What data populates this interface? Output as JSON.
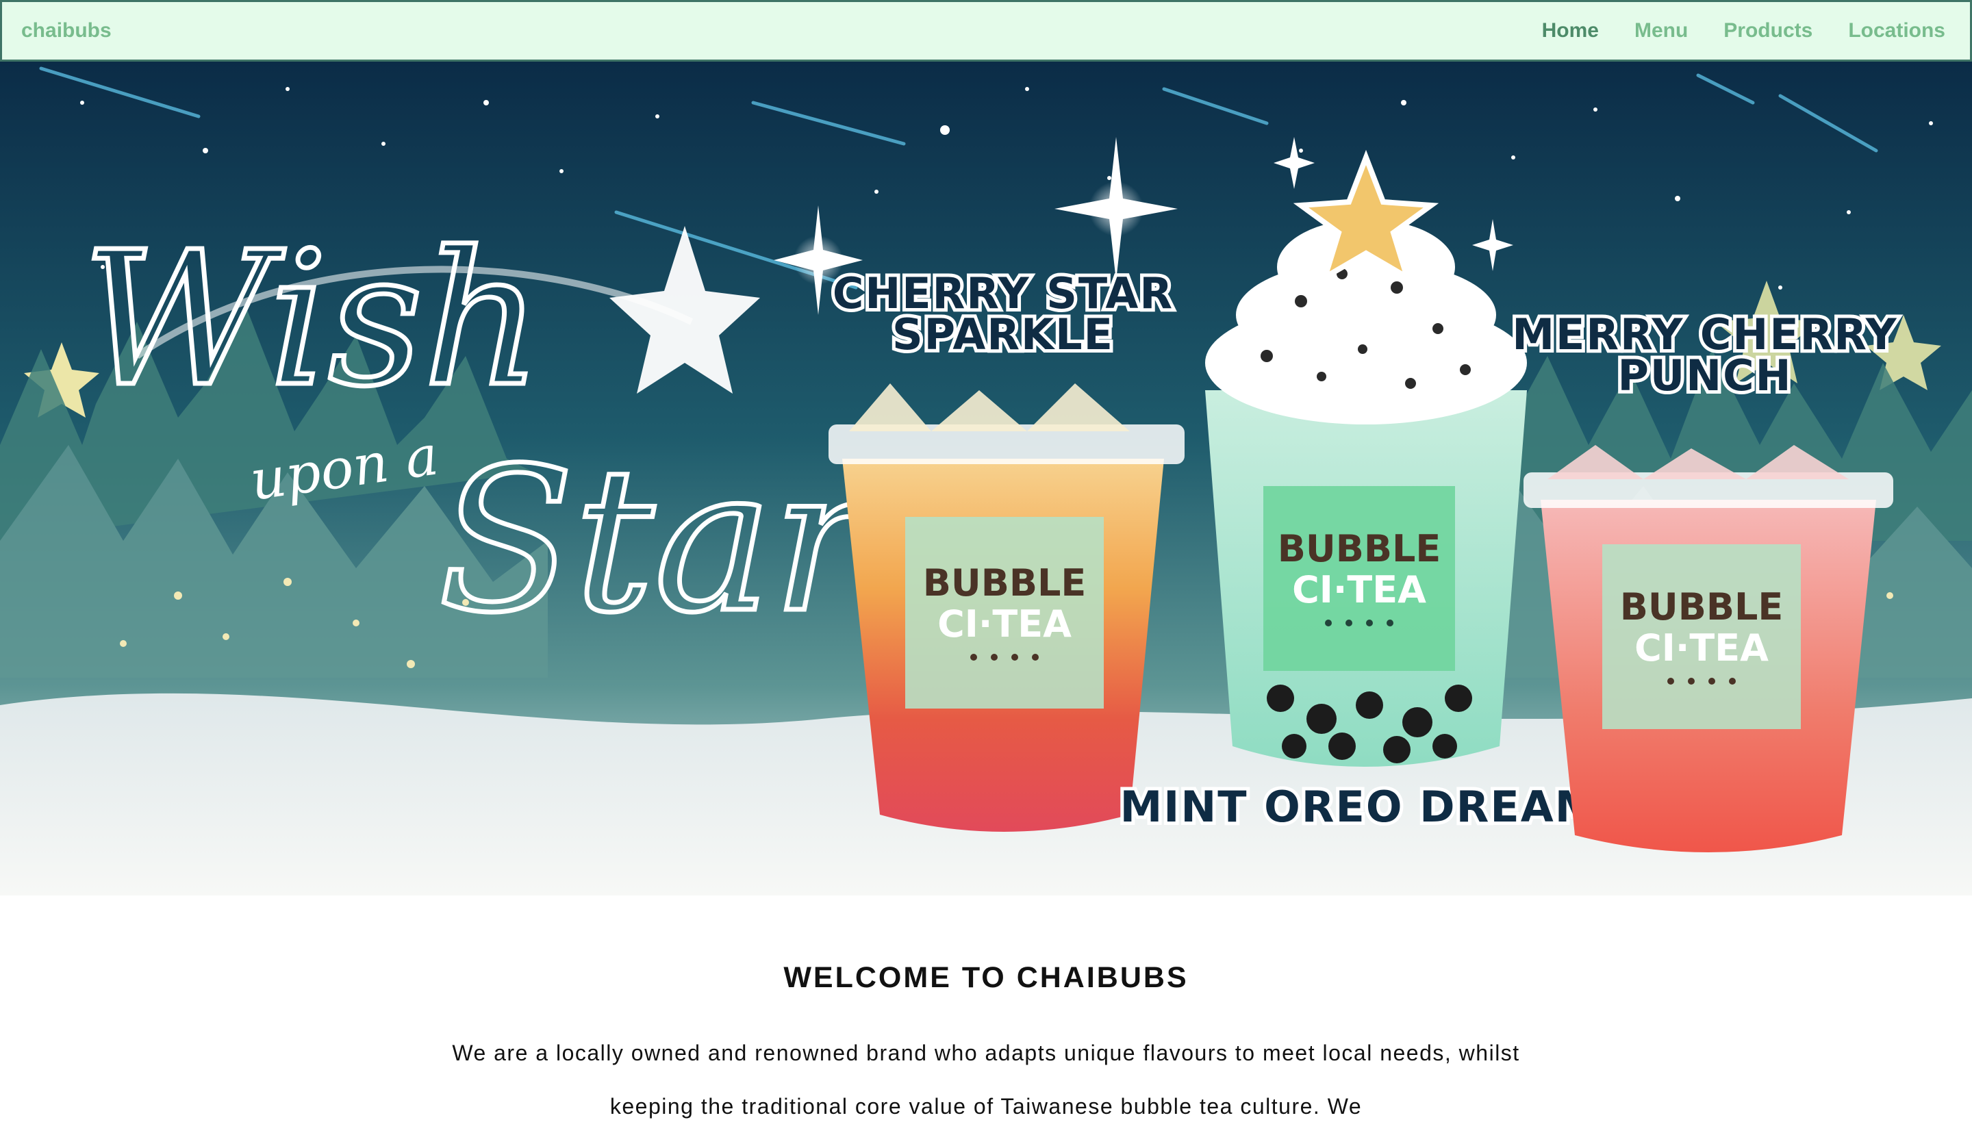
{
  "navbar": {
    "brand": "chaibubs",
    "links": [
      {
        "label": "Home",
        "active": true
      },
      {
        "label": "Menu",
        "active": false
      },
      {
        "label": "Products",
        "active": false
      },
      {
        "label": "Locations",
        "active": false
      }
    ]
  },
  "hero": {
    "script_wish": "Wish",
    "script_upon": "upon a",
    "script_star": "Star",
    "drinks": [
      {
        "line1": "CHERRY STAR",
        "line2": "SPARKLE"
      },
      {
        "line1": "MINT OREO DREAM",
        "line2": ""
      },
      {
        "line1": "MERRY CHERRY",
        "line2": "PUNCH"
      }
    ],
    "cup_brand_line1": "BUBBLE",
    "cup_brand_line2": "CI·TEA"
  },
  "welcome": {
    "title": "WELCOME TO CHAIBUBS",
    "text": "We are a locally owned and renowned brand who adapts unique flavours to meet local needs, whilst keeping the traditional core value of Taiwanese bubble tea culture. We"
  },
  "colors": {
    "navbar_bg": "#e4fbea",
    "nav_text": "#78bc8d",
    "nav_active": "#4d8b69"
  }
}
